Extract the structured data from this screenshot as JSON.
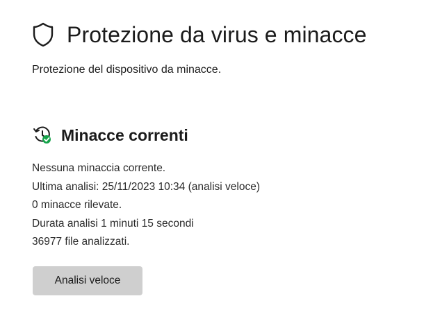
{
  "header": {
    "title": "Protezione da virus e minacce",
    "icon": "shield-icon"
  },
  "subtitle": "Protezione del dispositivo da minacce.",
  "current_threats": {
    "title": "Minacce correnti",
    "icon": "history-check-icon",
    "status_color": "#16a34a",
    "lines": [
      "Nessuna minaccia corrente.",
      "Ultima analisi: 25/11/2023 10:34 (analisi veloce)",
      "0 minacce rilevate.",
      "Durata analisi 1 minuti 15 secondi",
      "36977 file analizzati."
    ],
    "quick_scan_label": "Analisi veloce"
  }
}
